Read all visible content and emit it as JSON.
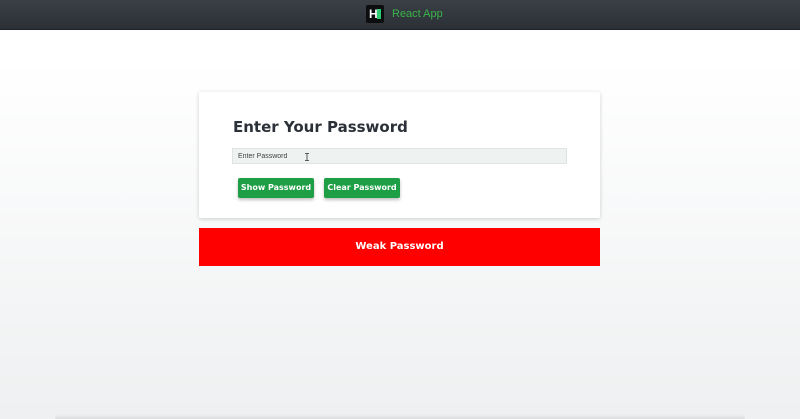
{
  "header": {
    "logo_letter": "H",
    "app_title": "React App",
    "accent_color": "#39b54a",
    "logo_icon": "hackerrank-logo-icon"
  },
  "card": {
    "title": "Enter Your Password",
    "password_input": {
      "value": "",
      "placeholder": "Enter Password"
    },
    "buttons": {
      "show_label": "Show Password",
      "clear_label": "Clear Password",
      "color": "#1e9e45"
    }
  },
  "strength": {
    "label": "Weak Password",
    "color": "#ff0000"
  },
  "cursor_icon": "text-cursor-icon"
}
